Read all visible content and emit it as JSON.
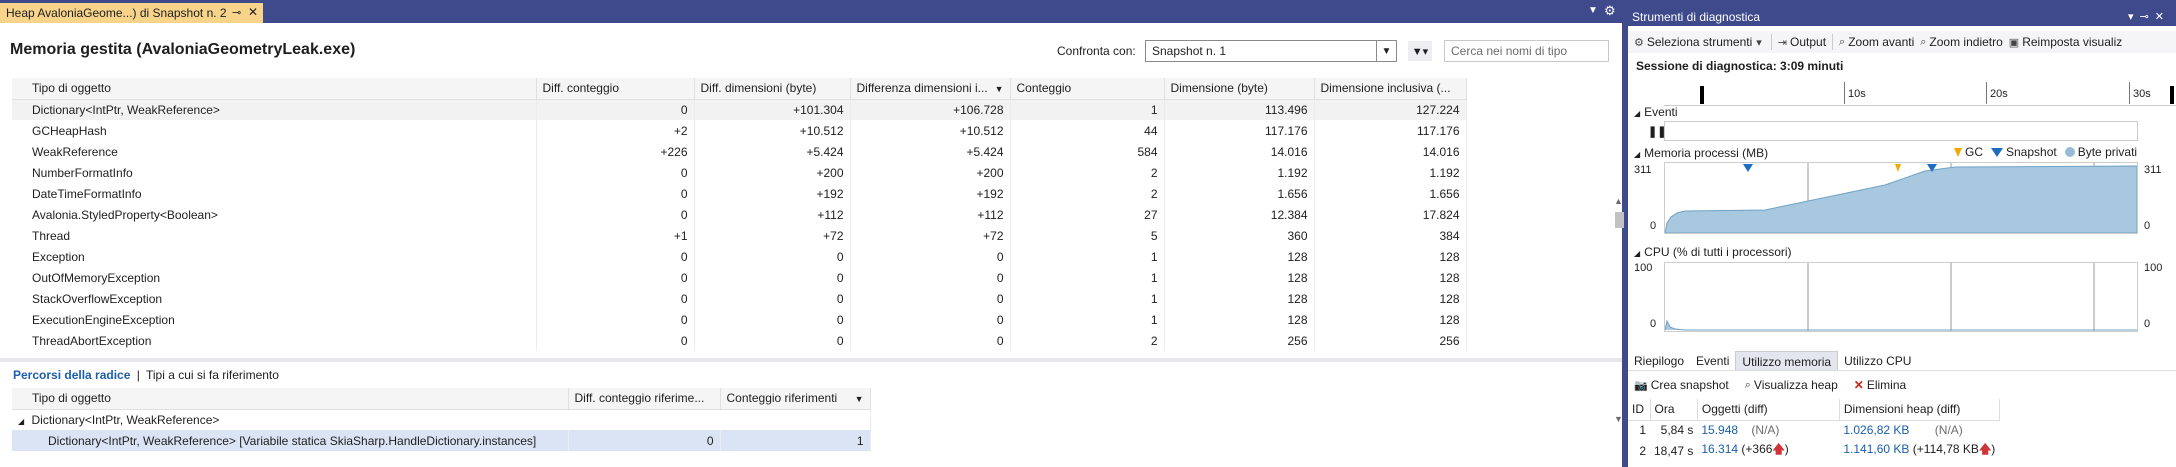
{
  "doc_tab": {
    "title": "Heap AvaloniaGeome...) di Snapshot n. 2",
    "pin_icon": "pin-icon",
    "close_icon": "close-icon"
  },
  "page": {
    "title": "Memoria gestita (AvaloniaGeometryLeak.exe)",
    "compare_label": "Confronta con:",
    "compare_value": "Snapshot n. 1",
    "search_placeholder": "Cerca nei nomi di tipo"
  },
  "grid": {
    "columns": [
      "Tipo di oggetto",
      "Diff. conteggio",
      "Diff. dimensioni (byte)",
      "Differenza dimensioni i...",
      "Conteggio",
      "Dimensione (byte)",
      "Dimensione inclusiva (..."
    ],
    "rows": [
      [
        "Dictionary<IntPtr, WeakReference>",
        "0",
        "+101.304",
        "+106.728",
        "1",
        "113.496",
        "127.224"
      ],
      [
        "GCHeapHash",
        "+2",
        "+10.512",
        "+10.512",
        "44",
        "117.176",
        "117.176"
      ],
      [
        "WeakReference",
        "+226",
        "+5.424",
        "+5.424",
        "584",
        "14.016",
        "14.016"
      ],
      [
        "NumberFormatInfo",
        "0",
        "+200",
        "+200",
        "2",
        "1.192",
        "1.192"
      ],
      [
        "DateTimeFormatInfo",
        "0",
        "+192",
        "+192",
        "2",
        "1.656",
        "1.656"
      ],
      [
        "Avalonia.StyledProperty<Boolean>",
        "0",
        "+112",
        "+112",
        "27",
        "12.384",
        "17.824"
      ],
      [
        "Thread",
        "+1",
        "+72",
        "+72",
        "5",
        "360",
        "384"
      ],
      [
        "Exception",
        "0",
        "0",
        "0",
        "1",
        "128",
        "128"
      ],
      [
        "OutOfMemoryException",
        "0",
        "0",
        "0",
        "1",
        "128",
        "128"
      ],
      [
        "StackOverflowException",
        "0",
        "0",
        "0",
        "1",
        "128",
        "128"
      ],
      [
        "ExecutionEngineException",
        "0",
        "0",
        "0",
        "1",
        "128",
        "128"
      ],
      [
        "ThreadAbortException",
        "0",
        "0",
        "0",
        "2",
        "256",
        "256"
      ]
    ]
  },
  "paths": {
    "tab_active": "Percorsi della radice",
    "separator": "|",
    "tab_other": "Tipi a cui si fa riferimento",
    "columns": [
      "Tipo di oggetto",
      "Diff. conteggio riferime...",
      "Conteggio riferimenti"
    ],
    "parent": "Dictionary<IntPtr, WeakReference>",
    "child": {
      "name": "Dictionary<IntPtr, WeakReference> [Variabile statica SkiaSharp.HandleDictionary.instances]",
      "diff": "0",
      "count": "1"
    }
  },
  "diag": {
    "title": "Strumenti di diagnostica",
    "toolbar": [
      "Seleziona strumenti",
      "Output",
      "Zoom avanti",
      "Zoom indietro",
      "Reimposta visualiz"
    ],
    "session": "Sessione di diagnostica: 3:09 minuti",
    "ruler": [
      "10s",
      "20s",
      "30s"
    ],
    "events_label": "Eventi",
    "mem_label": "Memoria processi (MB)",
    "legend": [
      "GC",
      "Snapshot",
      "Byte privati"
    ],
    "mem_max": "311",
    "mem_min": "0",
    "cpu_label": "CPU (% di tutti i processori)",
    "cpu_max": "100",
    "cpu_min": "0",
    "tabs": [
      "Riepilogo",
      "Eventi",
      "Utilizzo memoria",
      "Utilizzo CPU"
    ],
    "mem_toolbar": [
      "Crea snapshot",
      "Visualizza heap",
      "Elimina"
    ],
    "snap_columns": [
      "ID",
      "Ora",
      "Oggetti (diff)",
      "Dimensioni heap (diff)"
    ],
    "snapshots": [
      {
        "id": "1",
        "time": "5,84 s",
        "objects": "15.948",
        "objects_diff": "(N/A)",
        "heap": "1.026,82 KB",
        "heap_diff": "(N/A)"
      },
      {
        "id": "2",
        "time": "18,47 s",
        "objects": "16.314",
        "objects_diff": "(+366",
        "heap": "1.141,60 KB",
        "heap_diff": "(+114,78 KB"
      }
    ],
    "colors": {
      "memory_fill": "#a7c8df",
      "gc_marker": "#f2a900",
      "snapshot_marker": "#1b6ec2"
    }
  }
}
